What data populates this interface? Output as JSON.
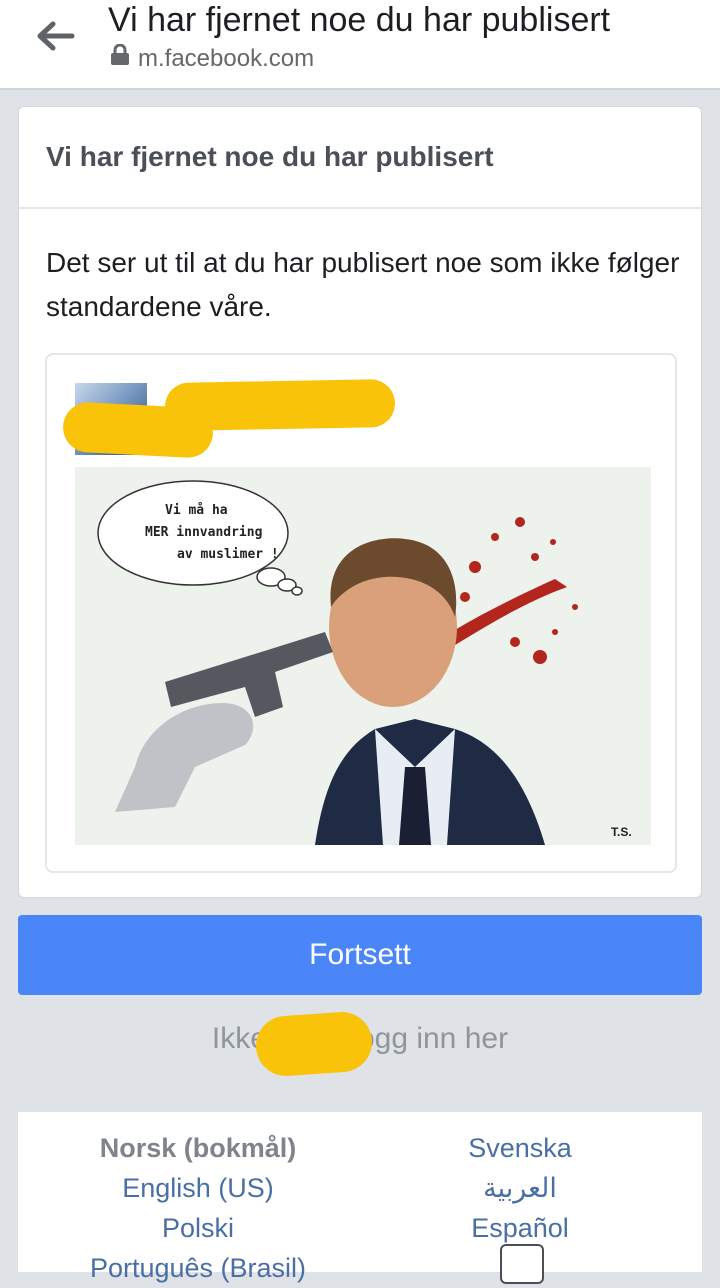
{
  "browser": {
    "title": "Vi har fjernet noe du har publisert",
    "url": "m.facebook.com"
  },
  "card": {
    "header": "Vi har fjernet noe du har publisert",
    "message": "Det ser ut til at du har publisert noe som ikke følger standardene våre."
  },
  "meme": {
    "bubble_line1": "Vi må ha",
    "bubble_line2": "MER innvandring",
    "bubble_line3": "av muslimer !",
    "signature": "T.S."
  },
  "actions": {
    "continue_label": "Fortsett",
    "login_prefix": "Ikke S",
    "login_suffix": "logg inn her"
  },
  "languages": {
    "left": [
      "Norsk (bokmål)",
      "English (US)",
      "Polski",
      "Português (Brasil)"
    ],
    "right": [
      "Svenska",
      "العربية",
      "Español"
    ]
  },
  "colors": {
    "primary": "#4a86f7",
    "redaction": "#f9c30a"
  },
  "icons": {
    "back": "arrow-left-icon",
    "lock": "lock-icon",
    "more": "more-languages-icon"
  }
}
